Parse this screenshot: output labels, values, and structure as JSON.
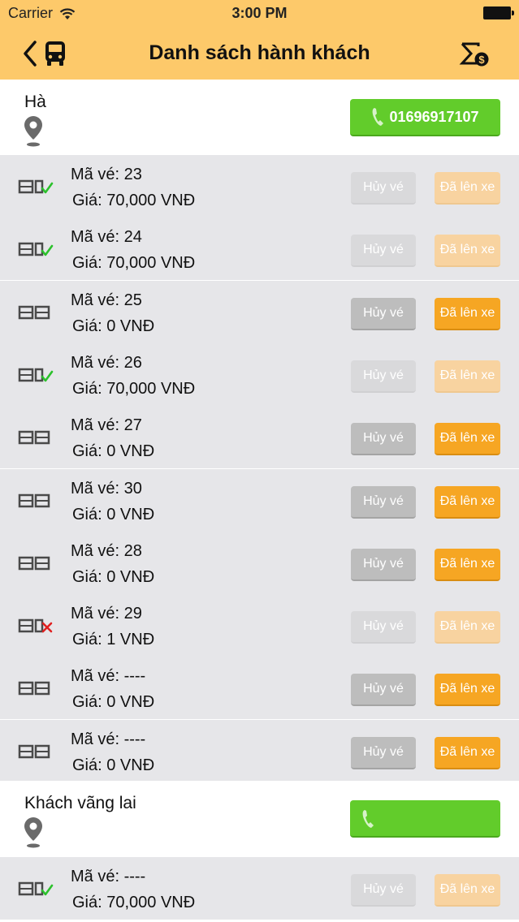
{
  "status_bar": {
    "carrier": "Carrier",
    "time": "3:00 PM"
  },
  "nav": {
    "title": "Danh sách hành khách"
  },
  "colors": {
    "header": "#fdc96a",
    "call_green": "#62cc2b",
    "board_orange": "#f6a623",
    "cancel_gray": "#bdbdbd"
  },
  "labels": {
    "cancel": "Hủy vé",
    "board": "Đã lên xe"
  },
  "groups": [
    {
      "name": "Hà",
      "phone": "01696917107",
      "tickets": [
        {
          "code": "Mã vé: 23",
          "price": "Giá: 70,000 VNĐ",
          "status": "checked",
          "enabled": false
        },
        {
          "code": "Mã vé: 24",
          "price": "Giá: 70,000 VNĐ",
          "status": "checked",
          "enabled": false
        },
        {
          "code": "Mã vé: 25",
          "price": "Giá: 0 VNĐ",
          "status": "normal",
          "enabled": true
        },
        {
          "code": "Mã vé: 26",
          "price": "Giá: 70,000 VNĐ",
          "status": "checked",
          "enabled": false
        },
        {
          "code": "Mã vé: 27",
          "price": "Giá: 0 VNĐ",
          "status": "normal",
          "enabled": true
        },
        {
          "code": "Mã vé: 30",
          "price": "Giá: 0 VNĐ",
          "status": "normal",
          "enabled": true
        },
        {
          "code": "Mã vé: 28",
          "price": "Giá: 0 VNĐ",
          "status": "normal",
          "enabled": true
        },
        {
          "code": "Mã vé: 29",
          "price": "Giá: 1 VNĐ",
          "status": "cancelled",
          "enabled": false
        },
        {
          "code": "Mã vé: ----",
          "price": "Giá: 0 VNĐ",
          "status": "normal",
          "enabled": true
        },
        {
          "code": "Mã vé: ----",
          "price": "Giá: 0 VNĐ",
          "status": "normal",
          "enabled": true
        }
      ]
    },
    {
      "name": "Khách vãng lai",
      "phone": "",
      "tickets": [
        {
          "code": "Mã vé: ----",
          "price": "Giá: 70,000 VNĐ",
          "status": "checked",
          "enabled": false
        }
      ]
    }
  ]
}
